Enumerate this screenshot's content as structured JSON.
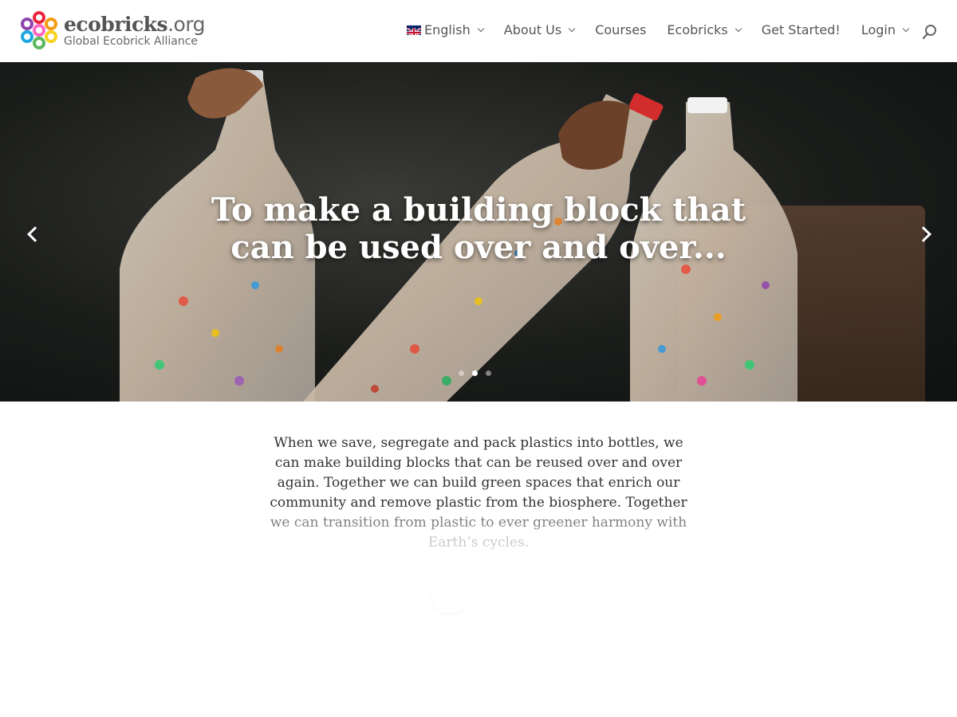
{
  "header": {
    "logo": {
      "title_main": "ecobricks",
      "title_tld": ".org",
      "subtitle": "Global Ecobrick Alliance",
      "ring_colors": [
        "#e8253b",
        "#f39c12",
        "#f7d21e",
        "#5bb85d",
        "#1ea7e1",
        "#8e44ad",
        "#ff66c4"
      ]
    },
    "nav": [
      {
        "label": "English",
        "has_dropdown": true,
        "icon": "uk-flag-icon"
      },
      {
        "label": "About Us",
        "has_dropdown": true
      },
      {
        "label": "Courses",
        "has_dropdown": false
      },
      {
        "label": "Ecobricks",
        "has_dropdown": true
      },
      {
        "label": "Get Started!",
        "has_dropdown": false
      },
      {
        "label": "Login",
        "has_dropdown": true
      }
    ],
    "search_icon": "search-icon"
  },
  "hero": {
    "title": "To make a building block that can be used over and over...",
    "prev_icon": "chevron-left-icon",
    "next_icon": "chevron-right-icon",
    "slide_count": 3,
    "active_slide": 1
  },
  "intro": {
    "line1": "When we save, segregate and pack plastics into bottles, we can make building blocks that can be reused over and over again. Together we can build green spaces that enrich our community and remove plastic from the biosphere.  Together",
    "line2": "we can transition from plastic to ever greener harmony with",
    "line3": "Earth’s cycles."
  },
  "colors": {
    "nav_text": "#555555",
    "hero_text": "#ffffff",
    "body_text": "#333333"
  }
}
